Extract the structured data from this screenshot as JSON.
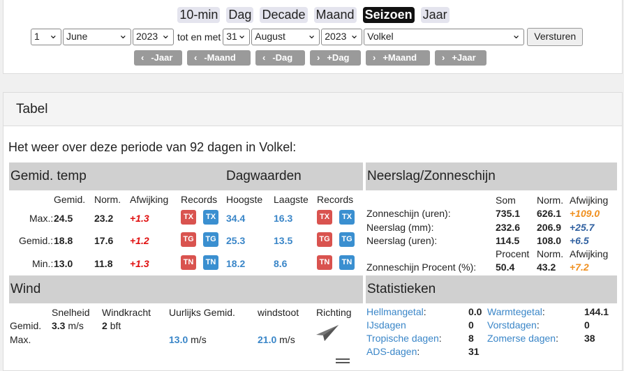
{
  "periods": [
    "10-min",
    "Dag",
    "Decade",
    "Maand",
    "Seizoen",
    "Jaar"
  ],
  "active_period": "Seizoen",
  "range": {
    "start_day": "1",
    "start_month": "June",
    "start_year": "2023",
    "between": "tot en met",
    "end_day": "31",
    "end_month": "August",
    "end_year": "2023",
    "station": "Volkel",
    "submit": "Versturen"
  },
  "nav_buttons": [
    "-Jaar",
    "-Maand",
    "-Dag",
    "+Dag",
    "+Maand",
    "+Jaar"
  ],
  "card_title": "Tabel",
  "period_title": "Het weer over deze periode van 92 dagen in Volkel:",
  "temp": {
    "title": "Gemid. temp",
    "day_title": "Dagwaarden",
    "headers": [
      "Gemid.",
      "Norm.",
      "Afwijking",
      "Records",
      "Hoogste",
      "Laagste",
      "Records"
    ],
    "rows": [
      {
        "label": "Max.:",
        "avg": "24.5",
        "norm": "23.2",
        "dev": "+1.3",
        "badge": "TX",
        "high": "34.4",
        "low": "16.3"
      },
      {
        "label": "Gemid.:",
        "avg": "18.8",
        "norm": "17.6",
        "dev": "+1.2",
        "badge": "TG",
        "high": "25.3",
        "low": "13.5"
      },
      {
        "label": "Min.:",
        "avg": "13.0",
        "norm": "11.8",
        "dev": "+1.3",
        "badge": "TN",
        "high": "18.2",
        "low": "8.6"
      }
    ]
  },
  "precip": {
    "title": "Neerslag/Zonneschijn",
    "headers": [
      "Som",
      "Norm.",
      "Afwijking"
    ],
    "rows": [
      {
        "label": "Zonneschijn (uren):",
        "sum": "735.1",
        "norm": "626.1",
        "dev": "+109.0",
        "color": "orange"
      },
      {
        "label": "Neerslag (mm):",
        "sum": "232.6",
        "norm": "206.9",
        "dev": "+25.7",
        "color": "navy"
      },
      {
        "label": "Neerslag (uren):",
        "sum": "114.5",
        "norm": "108.0",
        "dev": "+6.5",
        "color": "navy"
      }
    ],
    "pct_headers": [
      "Procent",
      "Norm.",
      "Afwijking"
    ],
    "pct_row": {
      "label": "Zonneschijn Procent (%):",
      "pct": "50.4",
      "norm": "43.2",
      "dev": "+7.2"
    }
  },
  "wind": {
    "title": "Wind",
    "headers": [
      "Snelheid",
      "Windkracht",
      "Uurlijks Gemid.",
      "windstoot",
      "Richting"
    ],
    "avg_label": "Gemid.",
    "avg_speed": "3.3",
    "avg_speed_unit": "m/s",
    "avg_force": "2",
    "avg_force_unit": "bft",
    "max_label": "Max.",
    "max_hourly": "13.0",
    "max_hourly_unit": "m/s",
    "max_gust": "21.0",
    "max_gust_unit": "m/s"
  },
  "stats": {
    "title": "Statistieken",
    "left": [
      {
        "label": "Hellmangetal",
        "value": "0.0"
      },
      {
        "label": "IJsdagen",
        "value": "0"
      },
      {
        "label": "Tropische dagen",
        "value": "8"
      },
      {
        "label": "ADS-dagen",
        "value": "31"
      }
    ],
    "right": [
      {
        "label": "Warmtegetal",
        "value": "144.1"
      },
      {
        "label": "Vorstdagen",
        "value": "0"
      },
      {
        "label": "Zomerse dagen",
        "value": "38"
      }
    ]
  }
}
